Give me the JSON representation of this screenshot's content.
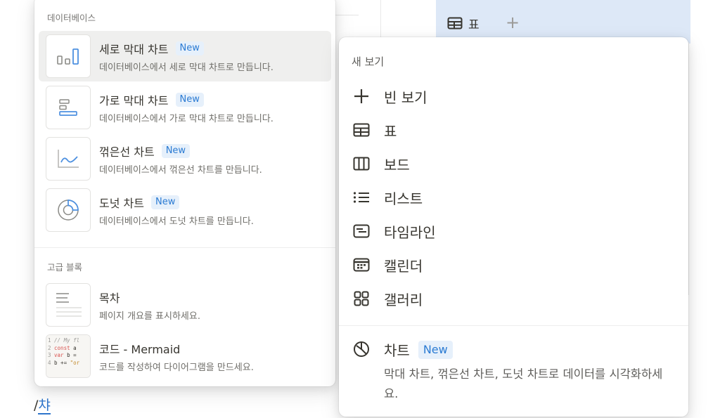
{
  "background": {
    "database_tab_label": "표",
    "add_view_glyph": "+",
    "slash_command": {
      "slash": "/",
      "typed": "챠"
    }
  },
  "block_menu": {
    "database_section": "데이터베이스",
    "database_items": [
      {
        "title": "세로 막대 차트",
        "badge": "New",
        "desc": "데이터베이스에서 세로 막대 차트로 만듭니다.",
        "icon": "vertical-bar-chart-icon"
      },
      {
        "title": "가로 막대 차트",
        "badge": "New",
        "desc": "데이터베이스에서 가로 막대 차트로 만듭니다.",
        "icon": "horizontal-bar-chart-icon"
      },
      {
        "title": "꺾은선 차트",
        "badge": "New",
        "desc": "데이터베이스에서 꺾은선 차트를 만듭니다.",
        "icon": "line-chart-icon"
      },
      {
        "title": "도넛 차트",
        "badge": "New",
        "desc": "데이터베이스에서 도넛 차트를 만듭니다.",
        "icon": "donut-chart-icon"
      }
    ],
    "advanced_section": "고급 블록",
    "advanced_items": [
      {
        "title": "목차",
        "desc": "페이지 개요를 표시하세요.",
        "icon": "table-of-contents-icon"
      },
      {
        "title": "코드 - Mermaid",
        "desc": "코드를 작성하여 다이어그램을 만드세요.",
        "icon": "code-preview-icon"
      }
    ],
    "code_preview": {
      "line1_num": "1",
      "line1_text": "// My fl",
      "line2_num": "2",
      "line2_kw": "const",
      "line2_text": " a",
      "line3_num": "3",
      "line3_kw": "var",
      "line3_text": " b =",
      "line4_num": "4",
      "line4_text": "b += ",
      "line4_str": "\"or"
    }
  },
  "view_menu": {
    "section": "새 보기",
    "items": [
      {
        "label": "빈 보기",
        "icon": "plus-icon"
      },
      {
        "label": "표",
        "icon": "table-icon"
      },
      {
        "label": "보드",
        "icon": "board-icon"
      },
      {
        "label": "리스트",
        "icon": "list-icon"
      },
      {
        "label": "타임라인",
        "icon": "timeline-icon"
      },
      {
        "label": "캘린더",
        "icon": "calendar-icon"
      },
      {
        "label": "갤러리",
        "icon": "gallery-icon"
      }
    ],
    "chart": {
      "label": "차트",
      "badge": "New",
      "desc": "막대 차트, 꺾은선 차트, 도넛 차트로 데이터를 시각화하세요.",
      "icon": "chart-icon"
    }
  },
  "colors": {
    "accent": "#2b7bd3",
    "badge_bg": "#e6f0fb",
    "hover_bg": "#efefee",
    "tabbar_bg": "#dde8f7"
  }
}
